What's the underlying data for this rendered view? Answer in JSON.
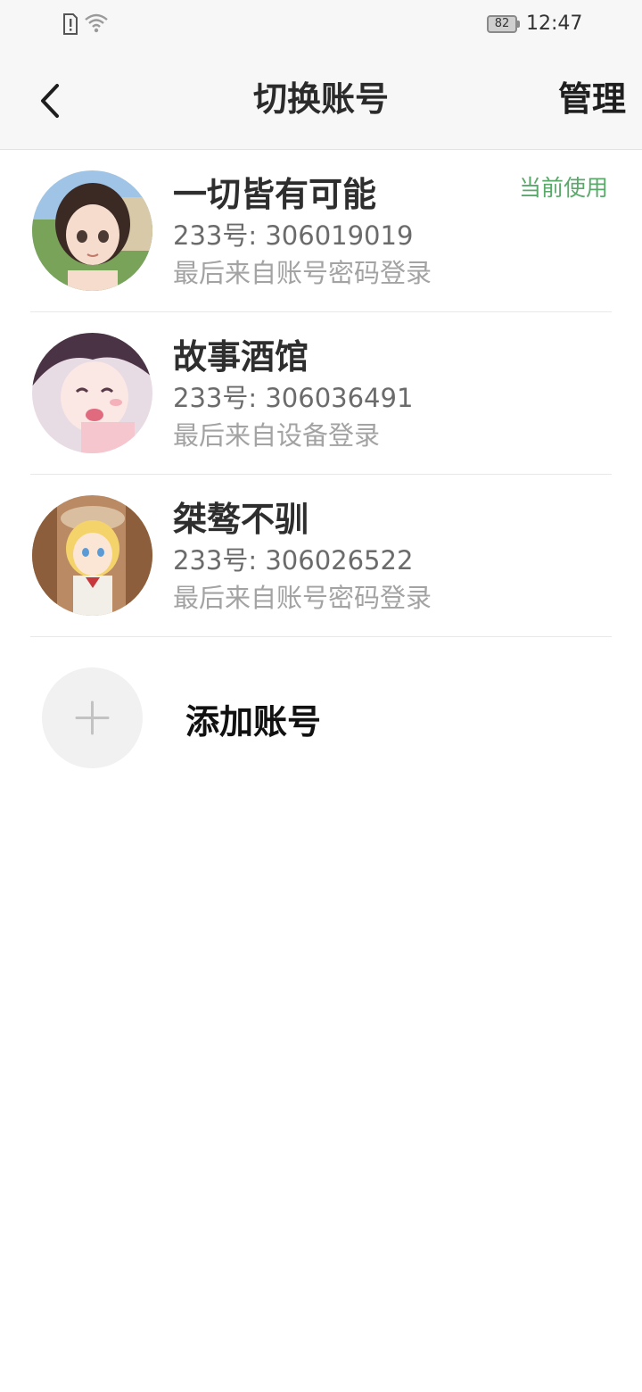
{
  "status_bar": {
    "battery": "82",
    "time": "12:47"
  },
  "header": {
    "title": "切换账号",
    "manage_label": "管理"
  },
  "accounts": [
    {
      "name": "一切皆有可能",
      "id_line": "233号: 306019019",
      "login_line": "最后来自账号密码登录",
      "badge": "当前使用"
    },
    {
      "name": "故事酒馆",
      "id_line": "233号: 306036491",
      "login_line": "最后来自设备登录"
    },
    {
      "name": "桀骜不驯",
      "id_line": "233号: 306026522",
      "login_line": "最后来自账号密码登录"
    }
  ],
  "add_account": {
    "label": "添加账号",
    "icon": "plus-icon"
  },
  "colors": {
    "badge_green": "#5aa96b",
    "header_bg": "#f7f7f7"
  }
}
